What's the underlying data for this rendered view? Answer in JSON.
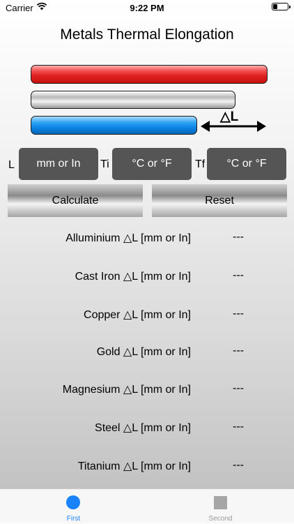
{
  "status_bar": {
    "carrier": "Carrier",
    "time": "9:22 PM",
    "battery_level_percent": 30
  },
  "page_title": "Metals Thermal Elongation",
  "diagram": {
    "delta_label": "△L",
    "colors": {
      "hot": "#e02020",
      "normal": "#c0c0c0",
      "cold": "#0a82e4"
    }
  },
  "inputs": {
    "length": {
      "label": "L",
      "placeholder": "mm or In"
    },
    "initial_temp": {
      "label": "Ti",
      "placeholder": "°C or °F"
    },
    "final_temp": {
      "label": "Tf",
      "placeholder": "°C or °F"
    }
  },
  "buttons": {
    "calculate": "Calculate",
    "reset": "Reset"
  },
  "results": [
    {
      "label": "Alluminium △L [mm or In]",
      "value": "---"
    },
    {
      "label": "Cast Iron △L [mm or In]",
      "value": "---"
    },
    {
      "label": "Copper △L [mm or In]",
      "value": "---"
    },
    {
      "label": "Gold △L [mm or In]",
      "value": "---"
    },
    {
      "label": "Magnesium △L [mm or In]",
      "value": "---"
    },
    {
      "label": "Steel △L [mm or In]",
      "value": "---"
    },
    {
      "label": "Titanium △L [mm or In]",
      "value": "---"
    }
  ],
  "tabbar": {
    "tabs": [
      {
        "label": "First",
        "icon": "circle-icon",
        "selected": true
      },
      {
        "label": "Second",
        "icon": "square-icon",
        "selected": false
      }
    ],
    "active_color": "#1a82fb",
    "inactive_color": "#999999"
  }
}
